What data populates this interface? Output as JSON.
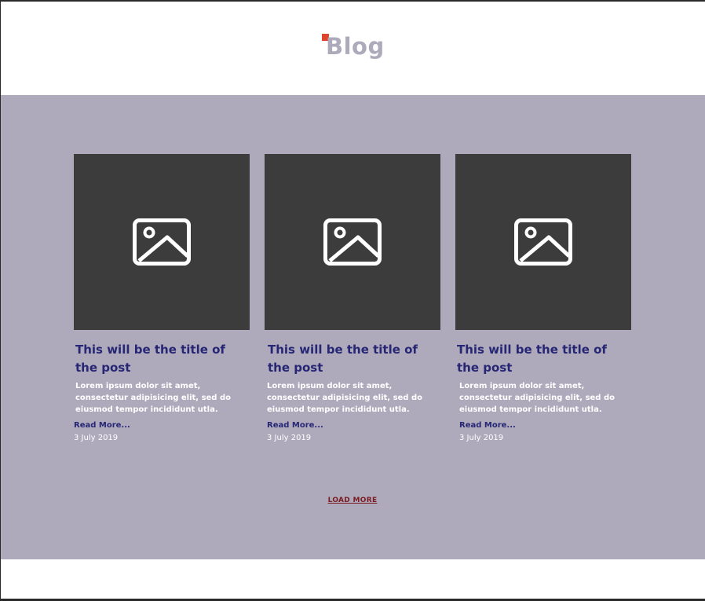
{
  "header": {
    "logo_text": "Blog",
    "accent_color": "#e0452c"
  },
  "posts": [
    {
      "image_icon": "image-placeholder-icon",
      "title": "This will be the title of the post",
      "excerpt": "Lorem ipsum dolor sit amet, consectetur adipisicing elit, sed do eiusmod tempor incididunt utla.",
      "read_more": "Read More...",
      "date": "3 July 2019"
    },
    {
      "image_icon": "image-placeholder-icon",
      "title": "This will be the title of the post",
      "excerpt": "Lorem ipsum dolor sit amet, consectetur adipisicing elit, sed do eiusmod tempor incididunt utla.",
      "read_more": "Read More...",
      "date": "3 July 2019"
    },
    {
      "image_icon": "image-placeholder-icon",
      "title": "This will be the title of the post",
      "excerpt": "Lorem ipsum dolor sit amet, consectetur adipisicing elit, sed do eiusmod tempor incididunt utla.",
      "read_more": "Read More...",
      "date": "3 July 2019"
    }
  ],
  "load_more_label": "LOAD MORE",
  "colors": {
    "main_background": "#aeaabb",
    "image_placeholder": "#3c3c3c",
    "title": "#262675",
    "load_more": "#7a1c22"
  }
}
